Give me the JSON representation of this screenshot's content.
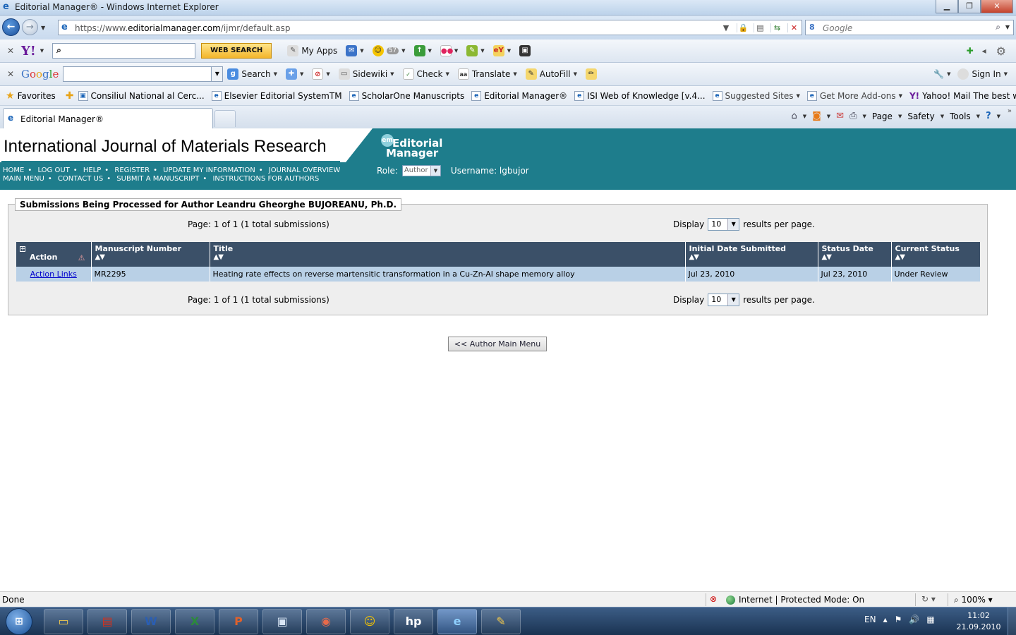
{
  "window": {
    "title": "Editorial Manager® - Windows Internet Explorer",
    "url_prefix": "https://www.",
    "url_domain": "editorialmanager.com",
    "url_path": "/ijmr/default.asp",
    "search_placeholder": "Google"
  },
  "yahoo_toolbar": {
    "logo": "Y!",
    "search_button": "WEB SEARCH",
    "items": [
      "My Apps"
    ],
    "mail_count": "57"
  },
  "google_toolbar": {
    "logo": "Google",
    "items": [
      "Search",
      "Sidewiki",
      "Check",
      "Translate",
      "AutoFill"
    ],
    "sign_in": "Sign In"
  },
  "favorites": {
    "label": "Favorites",
    "items": [
      "Consiliul National al Cerc...",
      "Elsevier Editorial SystemTM",
      "ScholarOne Manuscripts",
      "Editorial Manager®",
      "ISI Web of Knowledge [v.4...",
      "Suggested Sites",
      "Get More Add-ons",
      "Yahoo! Mail The best web..."
    ]
  },
  "tabs": {
    "active_tab": "Editorial Manager®",
    "commands": [
      "Page",
      "Safety",
      "Tools"
    ]
  },
  "banner": {
    "journal_title": "International Journal of Materials Research",
    "logo_line1": "Editorial",
    "logo_line2": "Manager",
    "logo_badge": "em",
    "nav_row1": [
      "HOME",
      "LOG OUT",
      "HELP",
      "REGISTER",
      "UPDATE MY INFORMATION",
      "JOURNAL OVERVIEW"
    ],
    "nav_row2": [
      "MAIN MENU",
      "CONTACT US",
      "SUBMIT A MANUSCRIPT",
      "INSTRUCTIONS FOR AUTHORS"
    ],
    "role_label": "Role:",
    "role_value": "Author",
    "username": "Username: lgbujor"
  },
  "content": {
    "legend": "Submissions Being Processed for Author Leandru Gheorghe BUJOREANU, Ph.D.",
    "pager_text": "Page: 1 of 1 (1 total submissions)",
    "display_label": "Display",
    "display_value": "10",
    "display_suffix": "results per page.",
    "columns": [
      "Action",
      "Manuscript Number",
      "Title",
      "Initial Date Submitted",
      "Status Date",
      "Current Status"
    ],
    "rows": [
      {
        "action": "Action Links",
        "manuscript_number": "MR2295",
        "title": "Heating rate effects on reverse martensitic transformation in a Cu-Zn-Al shape memory alloy",
        "initial_date": "Jul 23, 2010",
        "status_date": "Jul 23, 2010",
        "current_status": "Under Review"
      }
    ],
    "main_menu_button": "<< Author Main Menu"
  },
  "statusbar": {
    "left": "Done",
    "zone": "Internet | Protected Mode: On",
    "zoom": "100%"
  },
  "taskbar": {
    "language": "EN",
    "time": "11:02",
    "date": "21.09.2010"
  }
}
